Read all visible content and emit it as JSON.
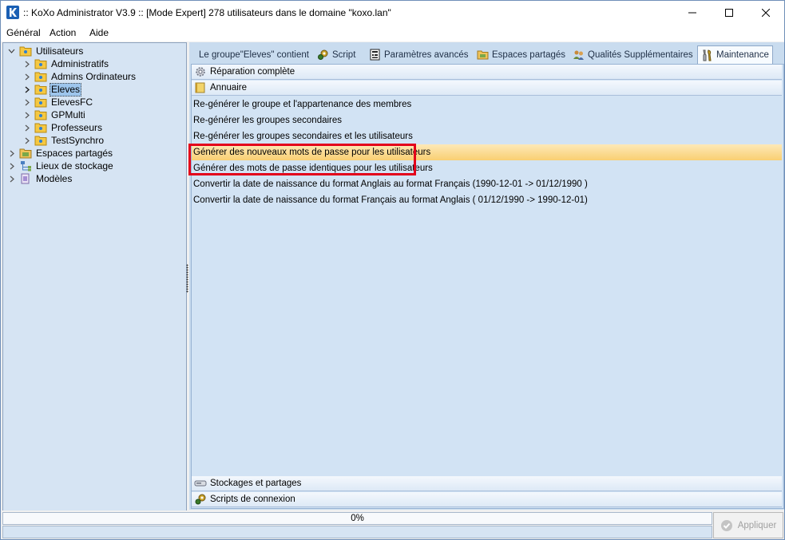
{
  "window": {
    "title": ":: KoXo Administrator V3.9 :: [Mode Expert] 278 utilisateurs dans le domaine \"koxo.lan\"",
    "accent": "#1a5fb4"
  },
  "menu": [
    "Général",
    "Action",
    "Aide"
  ],
  "tree": {
    "root_label": "Utilisateurs",
    "groups": [
      "Administratifs",
      "Admins Ordinateurs",
      "Eleves",
      "ElevesFC",
      "GPMulti",
      "Professeurs",
      "TestSynchro"
    ],
    "selected": "Eleves",
    "others": [
      "Espaces partagés",
      "Lieux de stockage",
      "Modèles"
    ]
  },
  "tabs": [
    {
      "label": "Le groupe\"Eleves\" contient",
      "icon": "none"
    },
    {
      "label": "Script",
      "icon": "gear-script-icon"
    },
    {
      "label": "Paramètres avancés",
      "icon": "settings-sheet-icon"
    },
    {
      "label": "Espaces partagés",
      "icon": "shared-folder-icon"
    },
    {
      "label": "Qualités Supplémentaires",
      "icon": "users-icon"
    },
    {
      "label": "Maintenance",
      "icon": "tools-icon"
    }
  ],
  "sections": {
    "repair": "Réparation complète",
    "directory": "Annuaire",
    "storage": "Stockages et partages",
    "login_scripts": "Scripts de connexion"
  },
  "actions": [
    "Re-générer le groupe et l'appartenance des membres",
    "Re-générer les groupes secondaires",
    "Re-générer les groupes secondaires et les utilisateurs",
    "Générer des nouveaux mots de passe pour les utilisateurs",
    "Générer des mots de passe identiques pour les utilisateurs",
    "Convertir la date de naissance du format Anglais au format Français (1990-12-01 -> 01/12/1990 )",
    "Convertir la date de naissance du format Français au format Anglais ( 01/12/1990 -> 1990-12-01)"
  ],
  "hovered_action": 3,
  "highlight_color": "#e3001b",
  "progress": {
    "text": "0%",
    "value": 0
  },
  "apply_button": "Appliquer"
}
